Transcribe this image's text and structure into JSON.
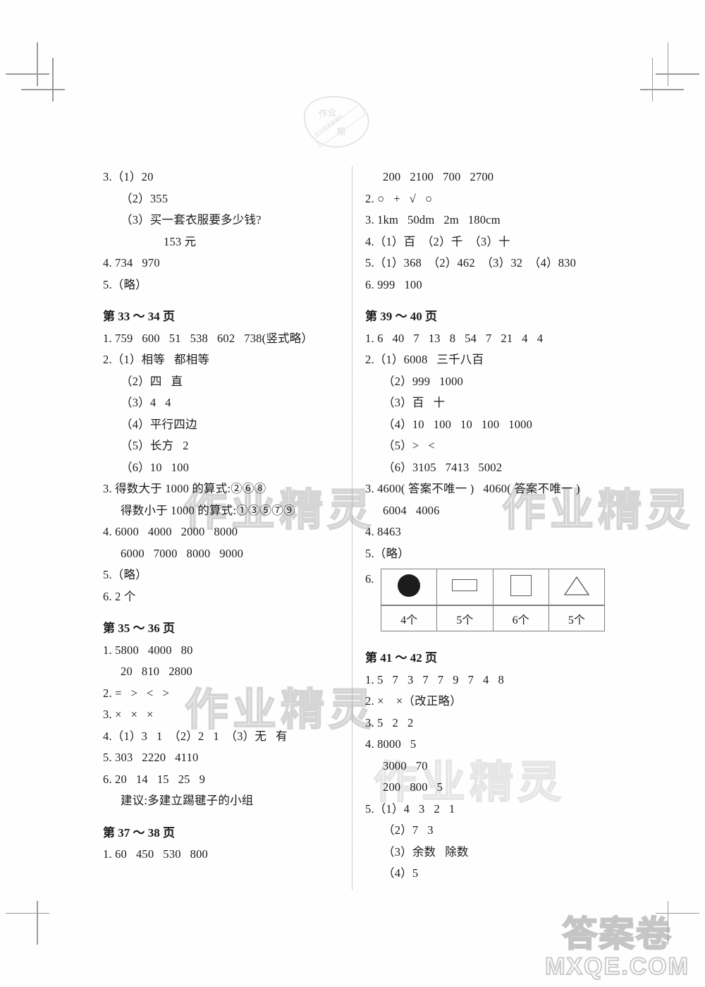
{
  "document": {
    "type": "answer-key-page",
    "watermark_logo_text": "作业帮",
    "watermarks": [
      "作业精灵",
      "作业精灵",
      "作业精灵",
      "作业精灵"
    ],
    "footer_watermark": {
      "line1": "答案卷",
      "line2": "MXQE.COM"
    }
  },
  "left_column": {
    "blocks": [
      {
        "lines": [
          {
            "indent": 0,
            "text": "3.（1）20"
          },
          {
            "indent": 1,
            "text": "（2）355"
          },
          {
            "indent": 1,
            "text": "（3）买一套衣服要多少钱?"
          },
          {
            "indent": 3,
            "text": "153 元"
          },
          {
            "indent": 0,
            "text": "4. 734   970"
          },
          {
            "indent": 0,
            "text": "5.（略）"
          }
        ]
      },
      {
        "heading": "第 33 ～ 34 页",
        "lines": [
          {
            "indent": 0,
            "text": "1. 759   600   51   538   602   738(竖式略）"
          },
          {
            "indent": 0,
            "text": "2.（1）相等   都相等"
          },
          {
            "indent": 1,
            "text": "（2）四   直"
          },
          {
            "indent": 1,
            "text": "（3）4   4"
          },
          {
            "indent": 1,
            "text": "（4）平行四边"
          },
          {
            "indent": 1,
            "text": "（5）长方   2"
          },
          {
            "indent": 1,
            "text": "（6）10   100"
          },
          {
            "indent": 0,
            "text": "3. 得数大于 1000 的算式:②⑥⑧"
          },
          {
            "indent": 1,
            "text": "得数小于 1000 的算式:①③⑤⑦⑨"
          },
          {
            "indent": 0,
            "text": "4. 6000   4000   2000   8000"
          },
          {
            "indent": 1,
            "text": "6000   7000   8000   9000"
          },
          {
            "indent": 0,
            "text": "5.（略）"
          },
          {
            "indent": 0,
            "text": "6. 2 个"
          }
        ]
      },
      {
        "heading": "第 35 ～ 36 页",
        "lines": [
          {
            "indent": 0,
            "text": "1. 5800   4000   80"
          },
          {
            "indent": 1,
            "text": "20   810   2800"
          },
          {
            "indent": 0,
            "text": "2. =   >   <   >"
          },
          {
            "indent": 0,
            "text": "3. ×   ×   ×"
          },
          {
            "indent": 0,
            "text": "4.（1）3   1  （2）2   1  （3）无   有"
          },
          {
            "indent": 0,
            "text": "5. 303   2220   4110"
          },
          {
            "indent": 0,
            "text": "6. 20   14   15   25   9"
          },
          {
            "indent": 1,
            "text": "建议:多建立踢毽子的小组"
          }
        ]
      },
      {
        "heading": "第 37 ～ 38 页",
        "lines": [
          {
            "indent": 0,
            "text": "1. 60   450   530   800"
          }
        ]
      }
    ]
  },
  "right_column": {
    "blocks": [
      {
        "lines": [
          {
            "indent": 1,
            "text": "200   2100   700   2700"
          },
          {
            "indent": 0,
            "text": "2. ○   +   √   ○"
          },
          {
            "indent": 0,
            "text": "3. 1km   50dm   2m   180cm"
          },
          {
            "indent": 0,
            "text": "4.（1）百  （2）千  （3）十"
          },
          {
            "indent": 0,
            "text": "5.（1）368  （2）462  （3）32  （4）830"
          },
          {
            "indent": 0,
            "text": "6. 999   100"
          }
        ]
      },
      {
        "heading": "第 39 ～ 40 页",
        "lines": [
          {
            "indent": 0,
            "text": "1. 6   40   7   13   8   54   7   21   4   4"
          },
          {
            "indent": 0,
            "text": "2.（1）6008   三千八百"
          },
          {
            "indent": 1,
            "text": "（2）999   1000"
          },
          {
            "indent": 1,
            "text": "（3）百   十"
          },
          {
            "indent": 1,
            "text": "（4）10   100   10   100   1000"
          },
          {
            "indent": 1,
            "text": "（5）>   <"
          },
          {
            "indent": 1,
            "text": "（6）3105   7413   5002"
          },
          {
            "indent": 0,
            "text": "3. 4600( 答案不唯一 )   4060( 答案不唯一 )"
          },
          {
            "indent": 1,
            "text": "6004   4006"
          },
          {
            "indent": 0,
            "text": "4. 8463"
          },
          {
            "indent": 0,
            "text": "5.（略）"
          }
        ],
        "table": {
          "item_number": "6.",
          "columns": [
            {
              "shape": "filled-circle",
              "count": "4个"
            },
            {
              "shape": "rectangle",
              "count": "5个"
            },
            {
              "shape": "square",
              "count": "6个"
            },
            {
              "shape": "triangle",
              "count": "5个"
            }
          ]
        }
      },
      {
        "heading": "第 41 ～ 42 页",
        "lines": [
          {
            "indent": 0,
            "text": "1. 5   7   3   7   7   9   7   4   8"
          },
          {
            "indent": 0,
            "text": "2. ×    ×（改正略）"
          },
          {
            "indent": 0,
            "text": "3. 5   2   2"
          },
          {
            "indent": 0,
            "text": "4. 8000   5"
          },
          {
            "indent": 1,
            "text": "3000   70"
          },
          {
            "indent": 1,
            "text": "200   800   5"
          },
          {
            "indent": 0,
            "text": "5.（1）4   3   2   1"
          },
          {
            "indent": 1,
            "text": "（2）7   3"
          },
          {
            "indent": 1,
            "text": "（3）余数   除数"
          },
          {
            "indent": 1,
            "text": "（4）5"
          }
        ]
      }
    ]
  }
}
